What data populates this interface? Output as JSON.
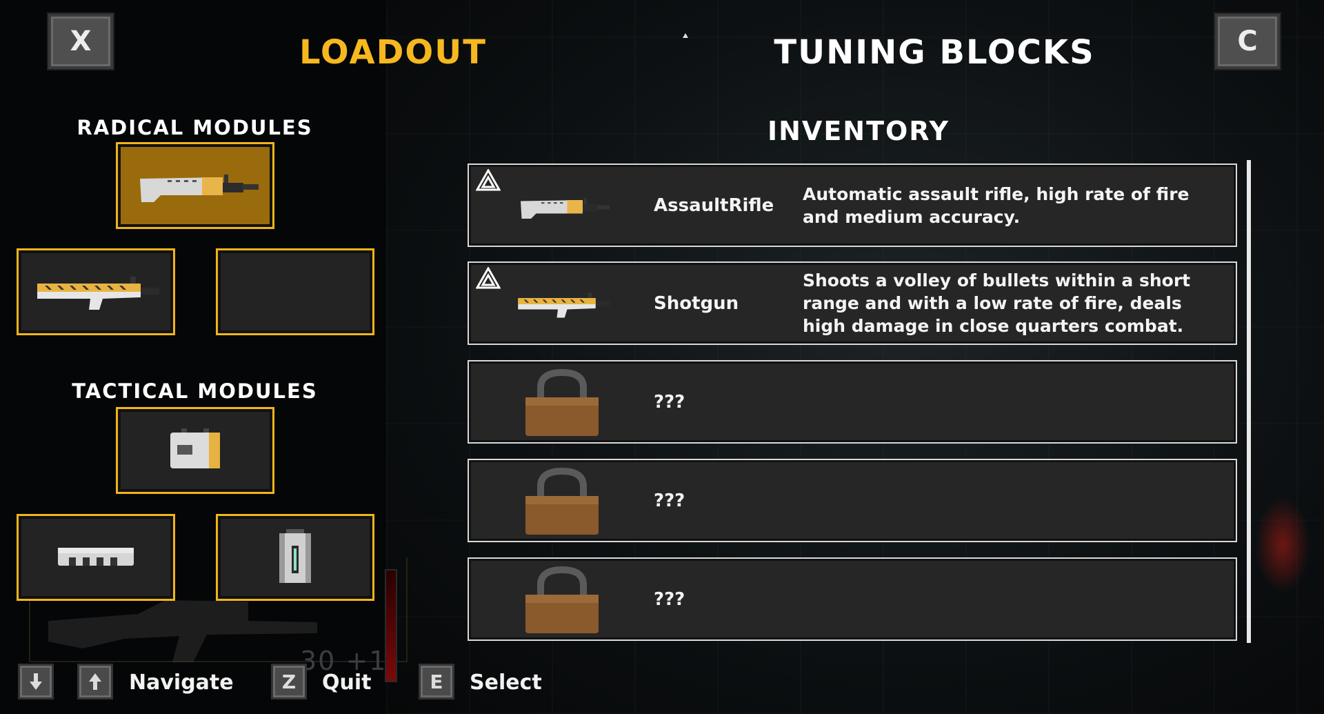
{
  "header": {
    "close_key": "X",
    "switch_key": "C",
    "tab_loadout": "LOADOUT",
    "tab_tuning": "TUNING BLOCKS",
    "accent": "#f6b81f"
  },
  "loadout": {
    "radical_title": "RADICAL MODULES",
    "tactical_title": "TACTICAL MODULES",
    "radical_slots": [
      {
        "item": "assault-rifle",
        "selected": true
      },
      {
        "item": "shotgun",
        "selected": false
      },
      {
        "item": "empty",
        "selected": false
      }
    ],
    "tactical_slots": [
      {
        "item": "battery-module"
      },
      {
        "item": "magazine-module"
      },
      {
        "item": "canister-module"
      }
    ]
  },
  "inventory": {
    "title": "INVENTORY",
    "items": [
      {
        "name": "AssaultRifle",
        "desc": "Automatic assault rifle, high rate of fire and medium accuracy.",
        "icon": "assault-rifle",
        "locked": false
      },
      {
        "name": "Shotgun",
        "desc": "Shoots a volley of bullets within a short range and with a low rate of fire, deals high damage in close quarters combat.",
        "icon": "shotgun",
        "locked": false
      },
      {
        "name": "???",
        "desc": "",
        "icon": "padlock",
        "locked": true
      },
      {
        "name": "???",
        "desc": "",
        "icon": "padlock",
        "locked": true
      },
      {
        "name": "???",
        "desc": "",
        "icon": "padlock",
        "locked": true
      }
    ]
  },
  "hud": {
    "ammo": "30 +1"
  },
  "controls": {
    "navigate": "Navigate",
    "quit_key": "Z",
    "quit": "Quit",
    "select_key": "E",
    "select": "Select"
  }
}
